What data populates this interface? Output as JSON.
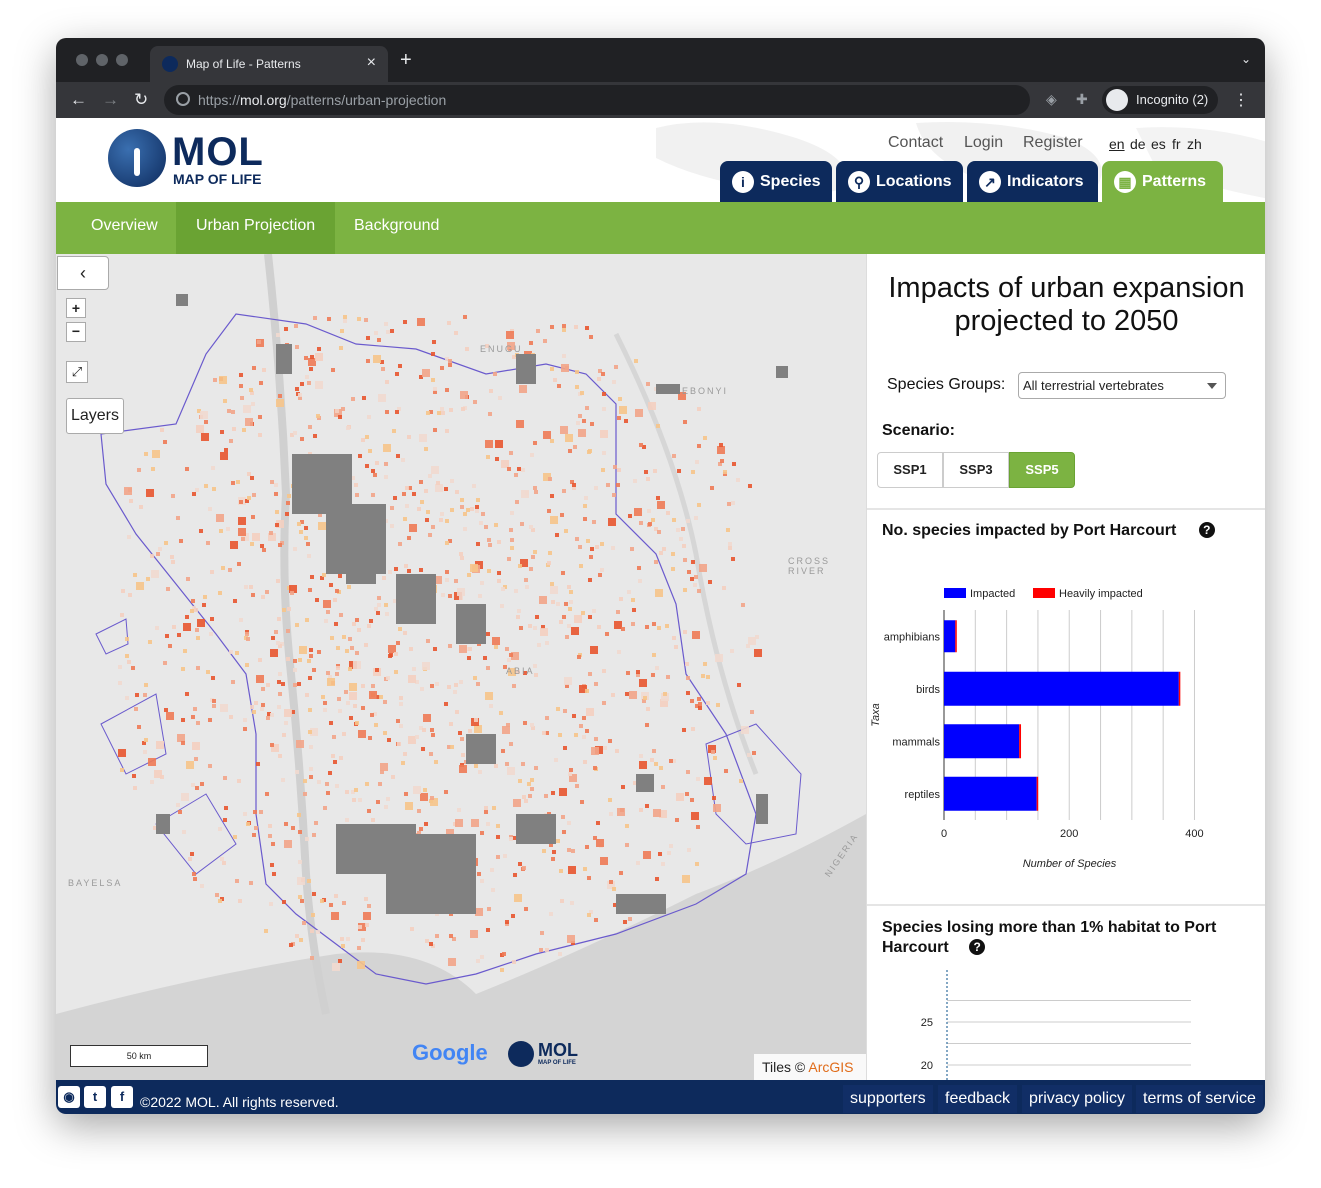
{
  "browser": {
    "tab_title": "Map of Life - Patterns",
    "url_scheme": "https://",
    "url_host": "mol.org",
    "url_path": "/patterns/urban-projection",
    "incognito_label": "Incognito (2)"
  },
  "header": {
    "logo_text": "MOL",
    "logo_subtext": "MAP OF LIFE",
    "links": [
      "Contact",
      "Login",
      "Register"
    ],
    "languages": [
      "en",
      "de",
      "es",
      "fr",
      "zh"
    ],
    "nav_tabs": [
      {
        "label": "Species",
        "icon": "info-icon"
      },
      {
        "label": "Locations",
        "icon": "location-pin-icon"
      },
      {
        "label": "Indicators",
        "icon": "chart-line-icon"
      },
      {
        "label": "Patterns",
        "icon": "grid-icon"
      }
    ]
  },
  "subnav": [
    "Overview",
    "Urban Projection",
    "Background"
  ],
  "map": {
    "layers_label": "Layers",
    "zoom_in": "+",
    "zoom_out": "−",
    "scale_label": "50 km",
    "region_labels": [
      "ENUGU",
      "EBONYI",
      "CROSS RIVER",
      "ABIA",
      "BAYELSA",
      "NIGERIA"
    ],
    "attribution_prefix": "Tiles ©",
    "attribution_link": "ArcGIS",
    "google_label": "Google",
    "mol_label": "MOL",
    "mol_sub": "MAP OF LIFE"
  },
  "panel": {
    "title": "Impacts of urban expansion projected to 2050",
    "species_groups_label": "Species Groups:",
    "species_groups_value": "All terrestrial vertebrates",
    "scenario_label": "Scenario:",
    "scenarios": [
      "SSP1",
      "SSP3",
      "SSP5"
    ],
    "active_scenario": "SSP5",
    "chart1_title": "No. species impacted by Port Harcourt",
    "chart2_title": "Species losing more than 1% habitat to Port Harcourt",
    "help_glyph": "?"
  },
  "chart_data": [
    {
      "type": "bar",
      "orientation": "horizontal",
      "categories": [
        "amphibians",
        "birds",
        "mammals",
        "reptiles"
      ],
      "series": [
        {
          "name": "Impacted",
          "color": "#0000ff",
          "values": [
            18,
            375,
            120,
            148
          ]
        },
        {
          "name": "Heavily impacted",
          "color": "#ff0000",
          "values": [
            1,
            2,
            3,
            2
          ]
        }
      ],
      "xlabel": "Number of Species",
      "ylabel": "Taxa",
      "xticks": [
        0,
        200,
        400
      ],
      "xlim": [
        0,
        420
      ],
      "legend": "top"
    },
    {
      "type": "line",
      "yticks": [
        20,
        25
      ],
      "grid": true
    }
  ],
  "footer": {
    "copyright": "©2022 MOL. All rights reserved.",
    "social": [
      "github-icon",
      "twitter-icon",
      "facebook-icon"
    ],
    "links": [
      "supporters",
      "feedback",
      "privacy policy",
      "terms of service"
    ]
  }
}
